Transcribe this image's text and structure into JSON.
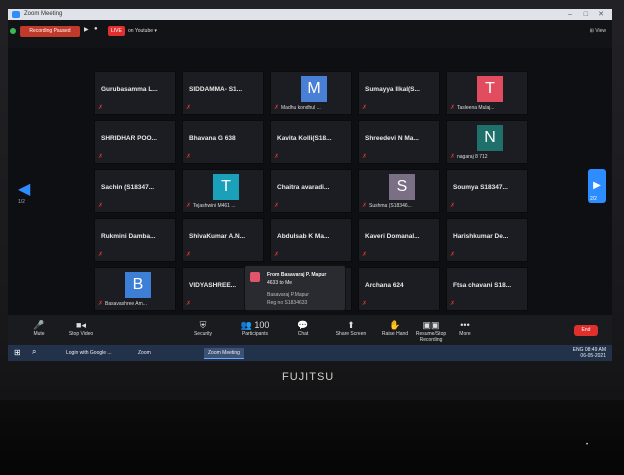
{
  "window": {
    "title": "Zoom Meeting",
    "minimize": "–",
    "maximize": "□",
    "close": "✕"
  },
  "topbar": {
    "record_label": "Recording Paused",
    "live_label": "LIVE",
    "live_on": "on Youtube ▾",
    "view_label": "⊞ View"
  },
  "tiles": [
    {
      "name": "Gurubasamma L..."
    },
    {
      "name": "SIDDAMMA- S1..."
    },
    {
      "name": "",
      "avatar": "M",
      "avatar_color": "#4a7fd6",
      "sub": "Madhu kondhul ..."
    },
    {
      "name": "Sumayya  Ilkal(S..."
    },
    {
      "name": "",
      "avatar": "T",
      "avatar_color": "#e14d5f",
      "sub": "Tasleena Mulaj..."
    },
    {
      "name": "SHRIDHAR  POO..."
    },
    {
      "name": "Bhavana G 638"
    },
    {
      "name": "Kavita Kolli(S18..."
    },
    {
      "name": "Shreedevi N Ma..."
    },
    {
      "name": "",
      "avatar": "N",
      "avatar_color": "#1f6f6a",
      "sub": "nagaraj 8 712"
    },
    {
      "name": "Sachin (S18347..."
    },
    {
      "name": "",
      "avatar": "T",
      "avatar_color": "#1aa0b8",
      "sub": "Tejashwini M461 ..."
    },
    {
      "name": "Chaitra  avaradi..."
    },
    {
      "name": "",
      "avatar": "S",
      "avatar_color": "#7b6f86",
      "sub": "Sushma (S18346..."
    },
    {
      "name": "Soumya  S18347..."
    },
    {
      "name": "Rukmini  Damba..."
    },
    {
      "name": "ShivaKumar  A.N..."
    },
    {
      "name": "Abdulsab  K Ma..."
    },
    {
      "name": "Kaveri  Domanal..."
    },
    {
      "name": "Harishkumar  De..."
    },
    {
      "name": "",
      "avatar": "B",
      "avatar_color": "#3d7fd6",
      "sub": "Basavashree Am..."
    },
    {
      "name": "VIDYASHREE..."
    },
    {
      "name": ""
    },
    {
      "name": "Archana 624"
    },
    {
      "name": "Ftsa chavani S18..."
    }
  ],
  "chat_popup": {
    "line1": "From Basavaraj P. Mapur",
    "line2": "4633 to Me",
    "line3": "Basavaraj P.Mapur",
    "line4": "Reg no S1834633"
  },
  "nav": {
    "left_page": "1/2",
    "right_page": "2/2"
  },
  "toolbar": {
    "items": [
      {
        "icon": "🎤",
        "label": "Mute"
      },
      {
        "icon": "■◂",
        "label": "Stop Video"
      },
      {
        "icon": "⛨",
        "label": "Security"
      },
      {
        "icon": "👥 100",
        "label": "Participants"
      },
      {
        "icon": "💬",
        "label": "Chat"
      },
      {
        "icon": "⬆",
        "label": "Share Screen"
      },
      {
        "icon": "✋",
        "label": "Raise Hand"
      },
      {
        "icon": "▣▣",
        "label": "Resume/Stop Recording"
      },
      {
        "icon": "•••",
        "label": "More"
      }
    ],
    "end_label": "End"
  },
  "taskbar": {
    "items": [
      "Login with Google ...",
      "Zoom",
      "Zoom Meeting"
    ],
    "tray_time": "08:49 AM",
    "tray_date": "06-05-2021",
    "tray_lang": "ENG"
  },
  "brand": "FUJITSU"
}
